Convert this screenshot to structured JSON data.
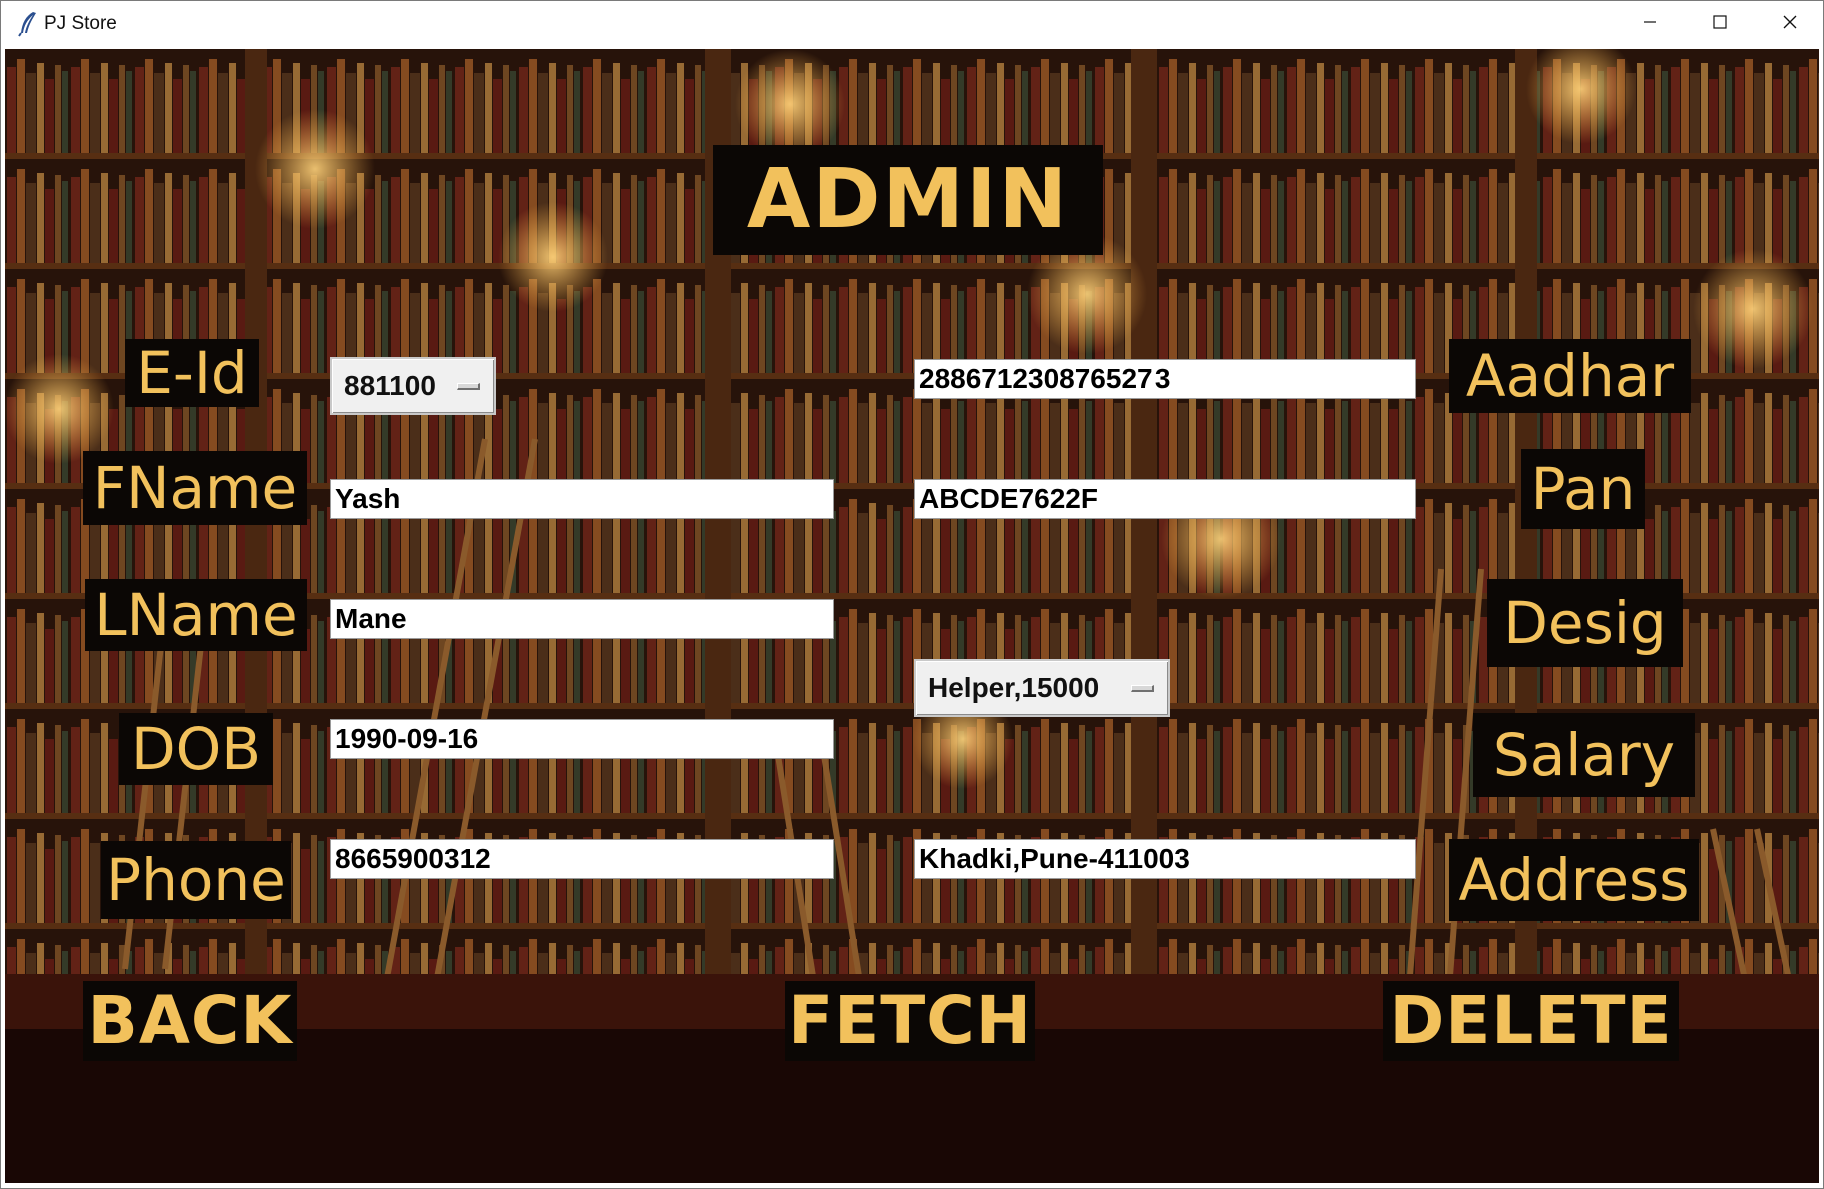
{
  "window": {
    "title": "PJ Store",
    "minimize_icon": "minimize-icon",
    "maximize_icon": "maximize-icon",
    "close_icon": "close-icon",
    "app_icon": "feather-icon"
  },
  "header": {
    "title": "ADMIN"
  },
  "labels": {
    "eid": "E-Id",
    "fname": "FName",
    "lname": "LName",
    "dob": "DOB",
    "phone": "Phone",
    "aadhar": "Aadhar",
    "pan": "Pan",
    "desig": "Desig",
    "salary": "Salary",
    "address": "Address"
  },
  "fields": {
    "eid": "881100",
    "fname": "Yash",
    "lname": "Mane",
    "dob": "1990-09-16",
    "phone": "8665900312",
    "aadhar": "288671230876527 3",
    "pan": "ABCDE7622F",
    "desig_salary": "Helper,15000",
    "address": "Khadki,Pune-411003"
  },
  "buttons": {
    "back": "BACK",
    "fetch": "FETCH",
    "delete": "DELETE"
  },
  "colors": {
    "label_text": "#f2c15c",
    "label_plate": "#0b0705"
  }
}
